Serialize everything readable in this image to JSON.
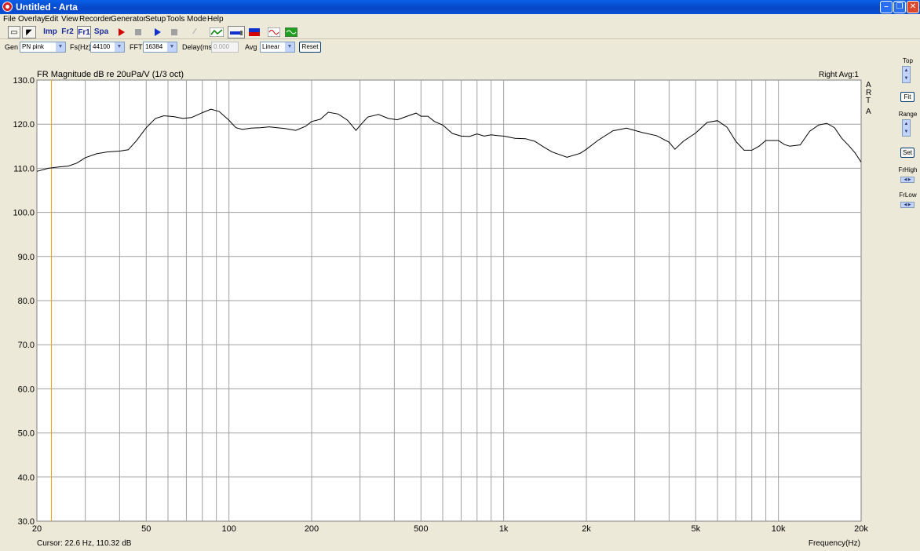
{
  "window": {
    "title": "Untitled - Arta"
  },
  "menu": [
    "File",
    "Overlay",
    "Edit",
    "View",
    "Recorder",
    "Generator",
    "Setup",
    "Tools",
    "Mode",
    "Help"
  ],
  "toolbar": {
    "imp_label": "Imp",
    "fr2_label": "Fr2",
    "fr1_label": "Fr1",
    "spa_label": "Spa"
  },
  "params": {
    "gen_label": "Gen",
    "gen_value": "PN pink",
    "fs_label": "Fs(Hz)",
    "fs_value": "44100",
    "fft_label": "FFT",
    "fft_value": "16384",
    "delay_label": "Delay(ms)",
    "delay_value": "0.000",
    "avg_label": "Avg",
    "avg_value": "Linear",
    "reset_label": "Reset"
  },
  "side": {
    "top_label": "Top",
    "fit_label": "Fit",
    "range_label": "Range",
    "set_label": "Set",
    "frhigh_label": "FrHigh",
    "frlow_label": "FrLow"
  },
  "plot": {
    "title": "FR Magnitude dB re 20uPa/V (1/3 oct)",
    "channel_info": "Right  Avg:1",
    "watermark": [
      "A",
      "R",
      "T",
      "A"
    ],
    "cursor_text": "Cursor:   22.6 Hz, 110.32 dB",
    "xlabel": "Frequency(Hz)",
    "colors": {
      "background": "#ffffff",
      "grid": "#a0a0a0",
      "trace": "#000000",
      "cursor": "#e8a000"
    }
  },
  "chart_data": {
    "type": "line",
    "title": "FR Magnitude dB re 20uPa/V (1/3 oct)",
    "xlabel": "Frequency(Hz)",
    "ylabel": "",
    "xscale": "log",
    "xlim": [
      20,
      20000
    ],
    "ylim": [
      30,
      130
    ],
    "grid": true,
    "x_ticks": [
      20,
      50,
      100,
      200,
      500,
      1000,
      2000,
      5000,
      10000,
      20000
    ],
    "x_tick_labels": [
      "20",
      "50",
      "100",
      "200",
      "500",
      "1k",
      "2k",
      "5k",
      "10k",
      "20k"
    ],
    "y_ticks": [
      30,
      40,
      50,
      60,
      70,
      80,
      90,
      100,
      110,
      120,
      130
    ],
    "y_tick_labels": [
      "30.0",
      "40.0",
      "50.0",
      "60.0",
      "70.0",
      "80.0",
      "90.0",
      "100.0",
      "110.0",
      "120.0",
      "130.0"
    ],
    "cursor": {
      "x": 22.6,
      "y": 110.32
    },
    "series": [
      {
        "x": [
          20,
          22,
          24,
          26,
          28,
          30,
          33,
          36,
          40,
          43,
          46,
          50,
          54,
          58,
          63,
          68,
          73,
          80,
          86,
          92,
          100,
          106,
          112,
          120,
          130,
          140,
          150,
          160,
          175,
          190,
          200,
          215,
          230,
          250,
          270,
          290,
          300,
          320,
          350,
          380,
          410,
          450,
          480,
          500,
          530,
          560,
          600,
          650,
          700,
          750,
          800,
          850,
          900,
          950,
          1000,
          1100,
          1200,
          1300,
          1400,
          1500,
          1700,
          1900,
          2000,
          2200,
          2500,
          2800,
          3200,
          3600,
          4000,
          4200,
          4500,
          5000,
          5500,
          6000,
          6500,
          7000,
          7500,
          8000,
          8500,
          9000,
          10000,
          10500,
          11000,
          12000,
          13000,
          14000,
          15000,
          16000,
          17000,
          18000,
          19000,
          20000
        ],
        "y": [
          109.3,
          110.0,
          110.3,
          110.5,
          111.2,
          112.4,
          113.3,
          113.7,
          113.9,
          114.2,
          116.2,
          119.2,
          121.3,
          121.9,
          121.7,
          121.3,
          121.5,
          122.6,
          123.4,
          122.9,
          120.9,
          119.2,
          118.8,
          119.1,
          119.2,
          119.4,
          119.2,
          119.0,
          118.6,
          119.5,
          120.6,
          121.1,
          122.7,
          122.3,
          120.9,
          118.6,
          119.7,
          121.6,
          122.2,
          121.3,
          121.0,
          121.9,
          122.5,
          121.8,
          121.8,
          120.6,
          119.8,
          117.9,
          117.3,
          117.2,
          117.8,
          117.3,
          117.6,
          117.4,
          117.3,
          116.8,
          116.7,
          116.1,
          114.8,
          113.7,
          112.5,
          113.4,
          114.3,
          116.3,
          118.5,
          119.1,
          118.1,
          117.4,
          115.9,
          114.3,
          116.1,
          118.0,
          120.4,
          120.8,
          119.3,
          116.1,
          114.1,
          114.1,
          115.0,
          116.3,
          116.3,
          115.4,
          115.0,
          115.3,
          118.4,
          119.8,
          120.2,
          119.2,
          116.8,
          115.2,
          113.5,
          111.4
        ]
      }
    ]
  }
}
